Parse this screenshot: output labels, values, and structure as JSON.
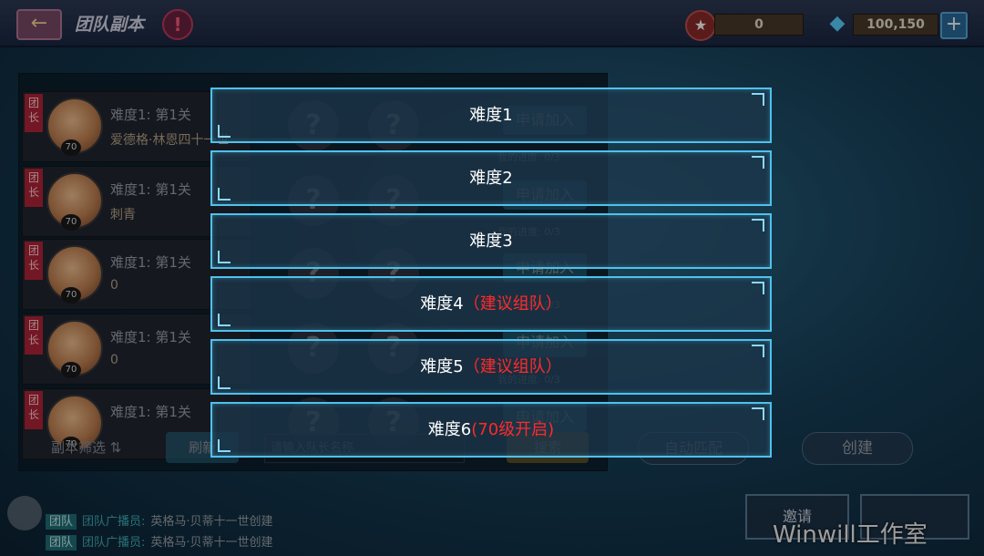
{
  "header": {
    "back_icon": "left-arrow-icon",
    "title": "团队副本",
    "help_icon": "exclamation-icon",
    "resource1_value": "0",
    "resource2_value": "100,150",
    "plus_label": "+"
  },
  "team_list": {
    "rows": [
      {
        "leader_tag": "团长",
        "level": "70",
        "stage": "难度1: 第1关",
        "name": "爱德格·林恩四十一世",
        "apply": "申请加入",
        "progress": "我的进度: 0/3"
      },
      {
        "leader_tag": "团长",
        "level": "70",
        "stage": "难度1: 第1关",
        "name": "刺青",
        "apply": "申请加入",
        "progress": "我的进度: 0/3"
      },
      {
        "leader_tag": "团长",
        "level": "70",
        "stage": "难度1: 第1关",
        "name": "0",
        "apply": "申请加入",
        "progress": "我的进度: 0/3"
      },
      {
        "leader_tag": "团长",
        "level": "70",
        "stage": "难度1: 第1关",
        "name": "0",
        "apply": "申请加入",
        "progress": "我的进度: 0/3"
      },
      {
        "leader_tag": "团长",
        "level": "70",
        "stage": "难度1: 第1关",
        "name": "",
        "apply": "申请加入",
        "progress": ""
      }
    ],
    "slot_placeholder": "?"
  },
  "controls": {
    "filter_label": "副本筛选",
    "refresh_label": "刷新",
    "search_placeholder": "请输入队长名称",
    "search_label": "搜索",
    "auto_match_label": "自动匹配",
    "create_label": "创建"
  },
  "chat": {
    "lines": [
      {
        "tag": "团队",
        "sys": "团队广播员:",
        "text": "英格马·贝蒂十一世创建"
      },
      {
        "tag": "团队",
        "sys": "团队广播员:",
        "text": "英格马·贝蒂十一世创建"
      }
    ]
  },
  "bottom_buttons": {
    "invite_label": "邀请"
  },
  "difficulty_menu": {
    "options": [
      {
        "label": "难度1",
        "hint": ""
      },
      {
        "label": "难度2",
        "hint": ""
      },
      {
        "label": "难度3",
        "hint": ""
      },
      {
        "label": "难度4",
        "hint": "（建议组队）"
      },
      {
        "label": "难度5",
        "hint": "（建议组队）"
      },
      {
        "label": "难度6",
        "hint": "(70级开启)"
      }
    ],
    "hint_color": "#ff2a2a",
    "border_color": "#4fc1ec"
  },
  "watermark": "Winwill工作室"
}
